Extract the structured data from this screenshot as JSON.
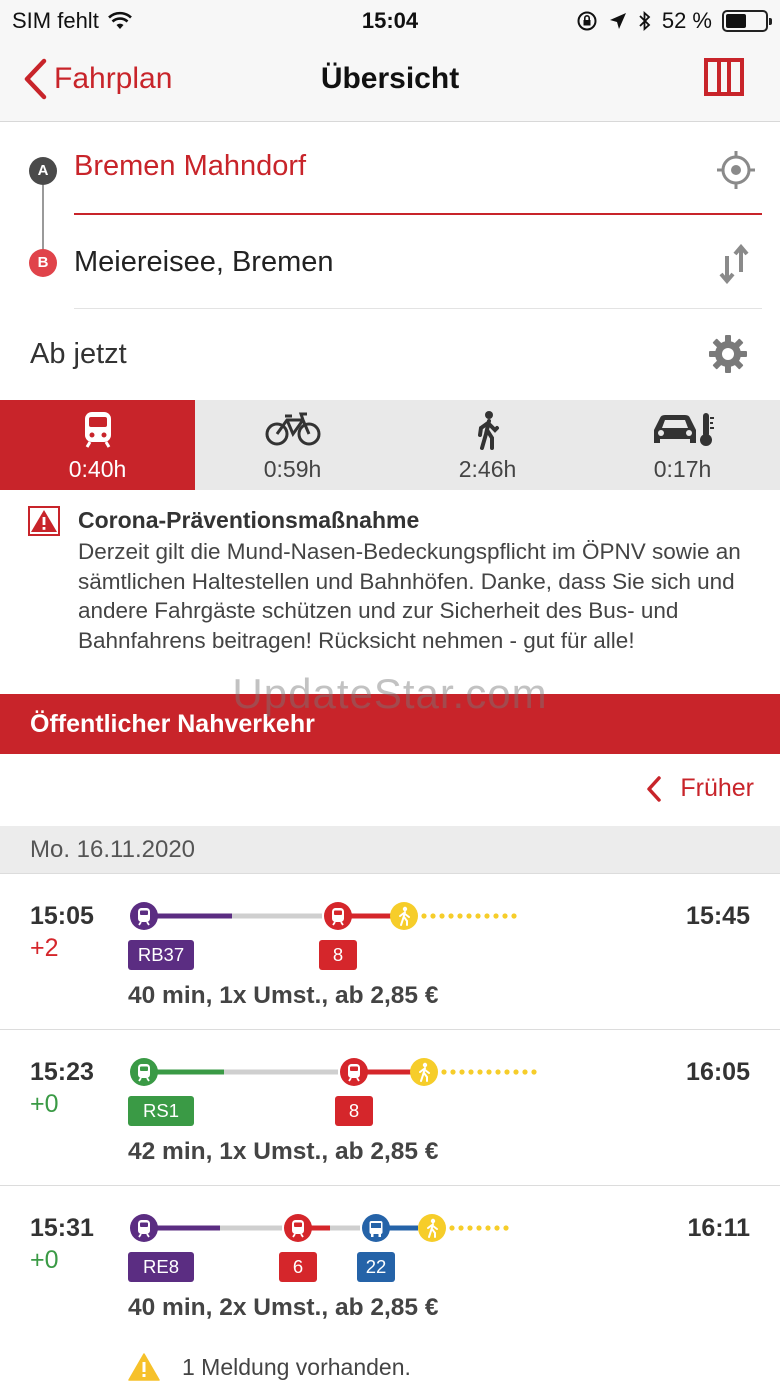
{
  "status_bar": {
    "carrier": "SIM fehlt",
    "time": "15:04",
    "battery_percent": "52 %",
    "battery_level": 0.52
  },
  "nav": {
    "back_label": "Fahrplan",
    "title": "Übersicht",
    "map_icon": "map-icon"
  },
  "route": {
    "from_badge": "A",
    "from": "Bremen Mahndorf",
    "to_badge": "B",
    "to": "Meiereisee, Bremen",
    "time": "Ab jetzt"
  },
  "modes": [
    {
      "icon": "train-icon",
      "label": "0:40h",
      "active": true
    },
    {
      "icon": "bicycle-icon",
      "label": "0:59h",
      "active": false
    },
    {
      "icon": "walking-icon",
      "label": "2:46h",
      "active": false
    },
    {
      "icon": "car-icon",
      "label": "0:17h",
      "active": false
    }
  ],
  "notice": {
    "title": "Corona-Präventionsmaßnahme",
    "body": "Derzeit gilt die Mund-Nasen-Bedeckungspflicht im ÖPNV sowie an sämtlichen Haltestellen und Bahnhöfen. Danke, dass Sie sich und andere Fahrgäste schützen und zur Sicherheit des Bus- und Bahnfahrens beitragen! Rücksicht nehmen - gut für alle!"
  },
  "section_title": "Öffentlicher Nahverkehr",
  "watermark": "UpdateStar.com",
  "earlier_label": "Früher",
  "date": "Mo. 16.11.2020",
  "colors": {
    "accent": "#c8242a",
    "regional_purple": "#5b2d82",
    "regional_green": "#3a9a45",
    "tram_red": "#d5262b",
    "bus_blue": "#2563a8",
    "walk_yellow": "#f6cd2a",
    "delay_red": "#d5262b",
    "ontime_green": "#3a9a45"
  },
  "connections": [
    {
      "departure": "15:05",
      "delay": "+2",
      "delay_color": "#d5262b",
      "arrival": "15:45",
      "summary": "40 min,  1x Umst.,  ab 2,85 €",
      "legs": [
        {
          "kind": "train",
          "color": "#5b2d82",
          "line": "RB37"
        },
        {
          "kind": "tram",
          "color": "#d5262b",
          "line": "8"
        },
        {
          "kind": "walk",
          "color": "#f6cd2a",
          "line": ""
        }
      ]
    },
    {
      "departure": "15:23",
      "delay": "+0",
      "delay_color": "#3a9a45",
      "arrival": "16:05",
      "summary": "42 min,  1x Umst.,  ab 2,85 €",
      "legs": [
        {
          "kind": "train",
          "color": "#3a9a45",
          "line": "RS1"
        },
        {
          "kind": "tram",
          "color": "#d5262b",
          "line": "8"
        },
        {
          "kind": "walk",
          "color": "#f6cd2a",
          "line": ""
        }
      ]
    },
    {
      "departure": "15:31",
      "delay": "+0",
      "delay_color": "#3a9a45",
      "arrival": "16:11",
      "summary": "40 min,  2x Umst.,  ab 2,85 €",
      "message": "1 Meldung vorhanden.",
      "legs": [
        {
          "kind": "train",
          "color": "#5b2d82",
          "line": "RE8"
        },
        {
          "kind": "tram",
          "color": "#d5262b",
          "line": "6"
        },
        {
          "kind": "bus",
          "color": "#2563a8",
          "line": "22"
        },
        {
          "kind": "walk",
          "color": "#f6cd2a",
          "line": ""
        }
      ]
    }
  ]
}
